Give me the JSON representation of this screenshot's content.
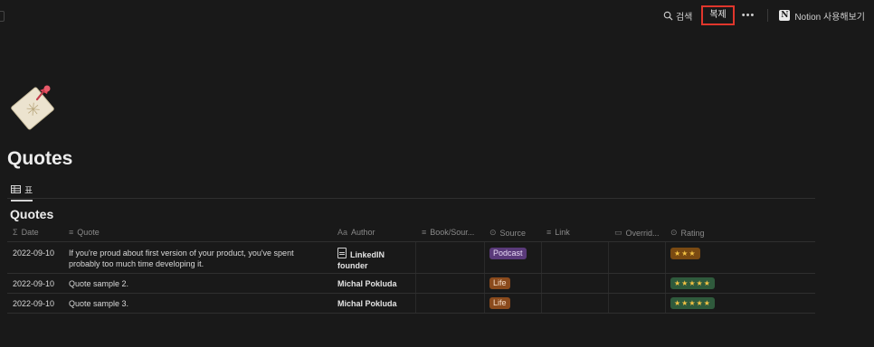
{
  "topbar": {
    "search_label": "검색",
    "duplicate_label": "복제",
    "more_label": "•••",
    "notion_logo": "N",
    "notion_label": "Notion 사용해보기"
  },
  "page": {
    "icon": "memo-pin-icon",
    "title": "Quotes"
  },
  "views": [
    {
      "icon": "table-icon",
      "label": "표"
    }
  ],
  "database": {
    "title": "Quotes",
    "columns": [
      {
        "icon": "Σ",
        "label": "Date"
      },
      {
        "icon": "≡",
        "label": "Quote"
      },
      {
        "icon": "Aa",
        "label": "Author"
      },
      {
        "icon": "≡",
        "label": "Book/Sour..."
      },
      {
        "icon": "⊙",
        "label": "Source"
      },
      {
        "icon": "≡",
        "label": "Link"
      },
      {
        "icon": "▭",
        "label": "Overrid..."
      },
      {
        "icon": "⊙",
        "label": "Rating"
      }
    ],
    "rows": [
      {
        "date": "2022-09-10",
        "quote_line1": "If you're proud about first version of your product, you've spent",
        "quote_line2": "probably too much time developing it.",
        "author_line1": "LinkedIN",
        "author_line2": "founder",
        "source": "Podcast",
        "rating": "★★★"
      },
      {
        "date": "2022-09-10",
        "quote": "Quote sample 2.",
        "author": "Michal Pokluda",
        "source": "Life",
        "rating": "★★★★★"
      },
      {
        "date": "2022-09-10",
        "quote": "Quote sample 3.",
        "author": "Michal Pokluda",
        "source": "Life",
        "rating": "★★★★★"
      }
    ]
  },
  "colors": {
    "background": "#191919",
    "highlight_border": "#e0362c",
    "tag_podcast": "#5a3a7a",
    "tag_life": "#8a4a1c",
    "rating_3": "#7a4a12",
    "rating_5": "#2f5a3c"
  }
}
